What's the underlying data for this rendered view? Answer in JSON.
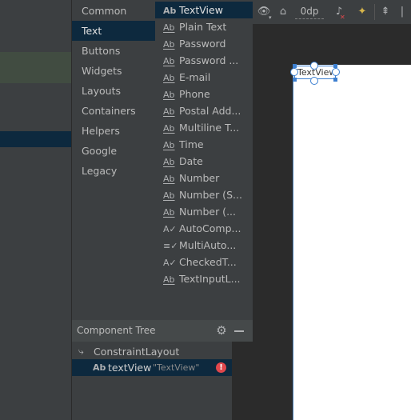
{
  "palette": {
    "categories": [
      {
        "label": "Common"
      },
      {
        "label": "Text"
      },
      {
        "label": "Buttons"
      },
      {
        "label": "Widgets"
      },
      {
        "label": "Layouts"
      },
      {
        "label": "Containers"
      },
      {
        "label": "Helpers"
      },
      {
        "label": "Google"
      },
      {
        "label": "Legacy"
      }
    ],
    "selected_category": "Text",
    "items": [
      {
        "icon": "Ab",
        "label": "TextView"
      },
      {
        "icon": "Ab",
        "label": "Plain Text"
      },
      {
        "icon": "Ab",
        "label": "Password"
      },
      {
        "icon": "Ab",
        "label": "Password ..."
      },
      {
        "icon": "Ab",
        "label": "E-mail"
      },
      {
        "icon": "Ab",
        "label": "Phone"
      },
      {
        "icon": "Ab",
        "label": "Postal Add..."
      },
      {
        "icon": "Ab",
        "label": "Multiline T..."
      },
      {
        "icon": "Ab",
        "label": "Time"
      },
      {
        "icon": "Ab",
        "label": "Date"
      },
      {
        "icon": "Ab",
        "label": "Number"
      },
      {
        "icon": "Ab",
        "label": "Number (S..."
      },
      {
        "icon": "Ab",
        "label": "Number (..."
      },
      {
        "icon": "A✓",
        "label": "AutoComp..."
      },
      {
        "icon": "≡✓",
        "label": "MultiAuto..."
      },
      {
        "icon": "A✓",
        "label": "CheckedT..."
      },
      {
        "icon": "Ab",
        "label": "TextInputL..."
      }
    ],
    "selected_item": "TextView"
  },
  "component_tree": {
    "title": "Component Tree",
    "root": {
      "label": "ConstraintLayout",
      "icon": "⤷"
    },
    "child": {
      "icon": "Ab",
      "label": "textView",
      "sublabel": "\"TextView\"",
      "error_icon": "!"
    }
  },
  "toolbar": {
    "eye_icon": "👁",
    "eye_drop": "▾",
    "magnet_icon": "⌂",
    "margin": "0dp",
    "clear_icon": "♪",
    "clear_x": "✕",
    "wand_icon": "✦",
    "align_icon": "⇞",
    "more_icon": "|"
  },
  "design": {
    "textview_text": "TextView"
  },
  "colors": {
    "selection": "#0d293e",
    "accent": "#3c7fd0",
    "error": "#e0474c"
  }
}
